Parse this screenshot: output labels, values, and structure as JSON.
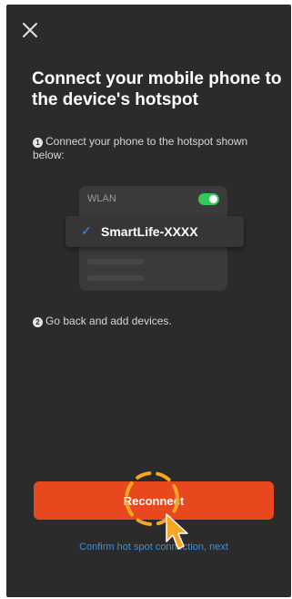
{
  "header": {
    "close_icon": "close-icon",
    "title": "Connect your mobile phone to the device's hotspot"
  },
  "steps": [
    {
      "number": "1",
      "text": "Connect your phone to the hotspot shown below:"
    },
    {
      "number": "2",
      "text": "Go back and add devices."
    }
  ],
  "wlan_card": {
    "label": "WLAN",
    "toggle_on": true,
    "selected_network": {
      "check_icon": "checkmark-icon",
      "name": "SmartLife-XXXX"
    }
  },
  "actions": {
    "reconnect_label": "Reconnect",
    "confirm_link": "Confirm hot spot connection, next"
  },
  "colors": {
    "background": "#2b2b2b",
    "accent_button": "#e8481e",
    "link": "#3a8ee6",
    "toggle": "#34c759",
    "tap_highlight": "#f5a623"
  }
}
